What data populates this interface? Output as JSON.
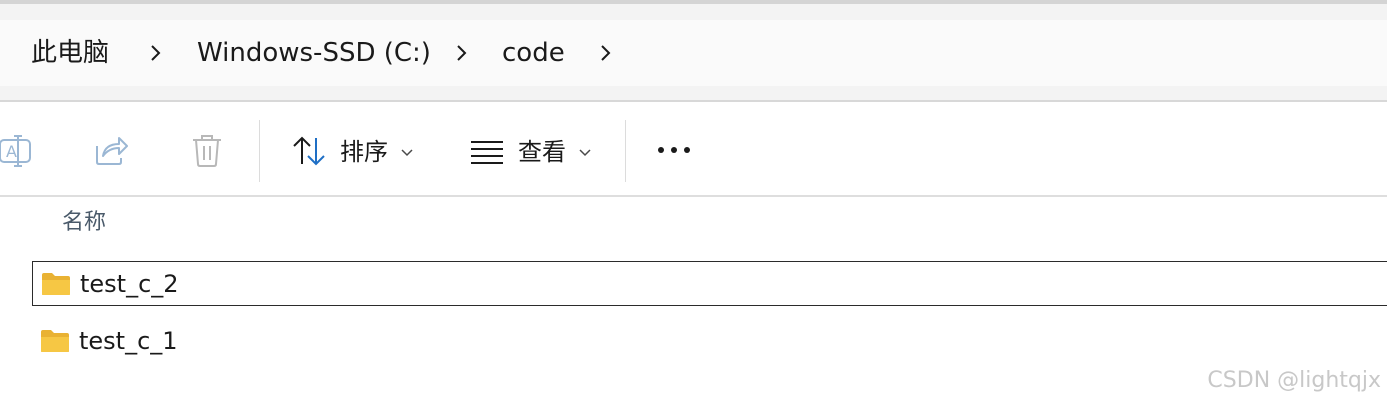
{
  "breadcrumb": {
    "items": [
      {
        "label": "此电脑"
      },
      {
        "label": "Windows-SSD (C:)"
      },
      {
        "label": "code"
      }
    ]
  },
  "toolbar": {
    "sort_label": "排序",
    "view_label": "查看"
  },
  "file_list": {
    "column_name": "名称",
    "rows": [
      {
        "name": "test_c_2",
        "selected": true
      },
      {
        "name": "test_c_1",
        "selected": false
      }
    ]
  },
  "watermark": "CSDN @lightqjx",
  "colors": {
    "folder": "#f6c744",
    "accent": "#1f6fc5"
  },
  "icons": {
    "rename": "rename-icon",
    "share": "share-icon",
    "delete": "trash-icon",
    "sort": "sort-arrows-icon",
    "view": "view-list-icon",
    "more": "more-icon",
    "chevron": "chevron-right-icon",
    "folder": "folder-icon"
  }
}
